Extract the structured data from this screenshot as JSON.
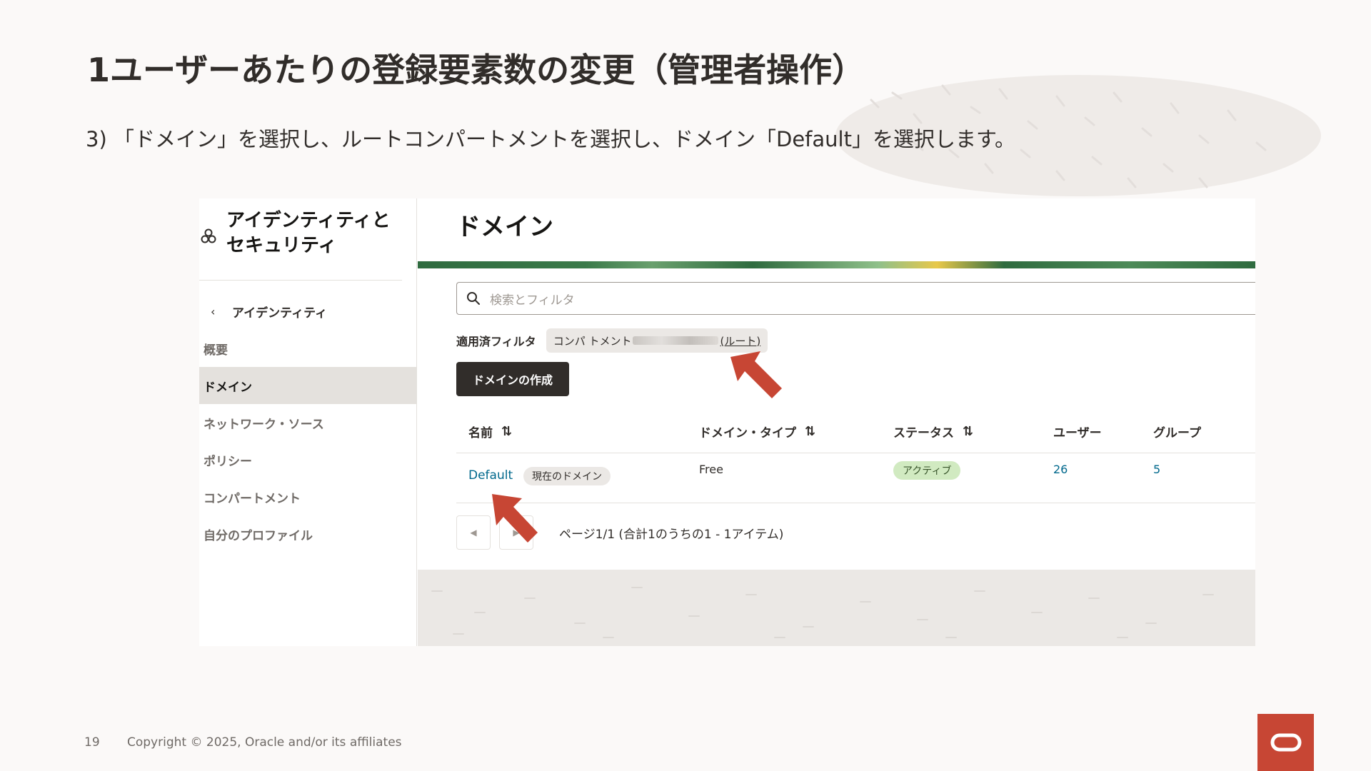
{
  "slide": {
    "title": "1ユーザーあたりの登録要素数の変更（管理者操作）",
    "subtitle": "3) 「ドメイン」を選択し、ルートコンパートメントを選択し、ドメイン「Default」を選択します。",
    "page_number": "19",
    "copyright": "Copyright © 2025, Oracle and/or its affiliates"
  },
  "sidebar": {
    "title": "アイデンティティと セキュリティ",
    "back_label": "アイデンティティ",
    "items": [
      {
        "label": "概要"
      },
      {
        "label": "ドメイン"
      },
      {
        "label": "ネットワーク・ソース"
      },
      {
        "label": "ポリシー"
      },
      {
        "label": "コンパートメント"
      },
      {
        "label": "自分のプロファイル"
      }
    ]
  },
  "main": {
    "title": "ドメイン",
    "search_placeholder": "検索とフィルタ",
    "filter_label": "適用済フィルタ",
    "filter_chip_prefix": "コンパ トメント",
    "filter_chip_suffix": "(ルート)",
    "create_button": "ドメインの作成",
    "table": {
      "headers": [
        "名前",
        "ドメイン・タイプ",
        "ステータス",
        "ユーザー",
        "グループ"
      ],
      "rows": [
        {
          "name": "Default",
          "badge": "現在のドメイン",
          "type": "Free",
          "status": "アクティブ",
          "users": "26",
          "groups": "5"
        }
      ]
    },
    "pager_text": "ページ1/1 (合計1のうちの1 - 1アイテム)"
  },
  "colors": {
    "brand_red": "#c74634",
    "link": "#00688c",
    "status_green": "#d1eac1",
    "dark_button": "#312d2a"
  }
}
